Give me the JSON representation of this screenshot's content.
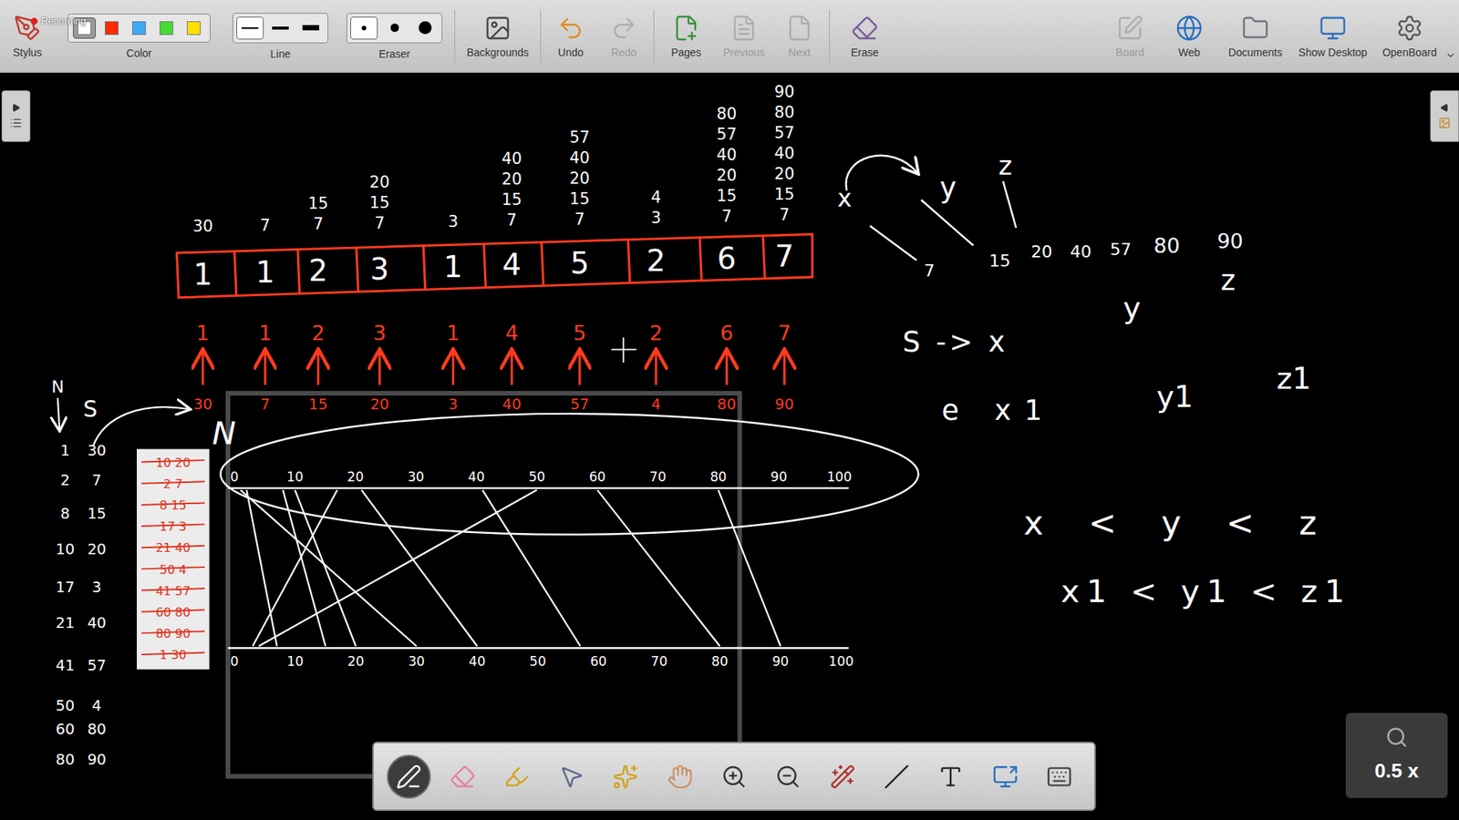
{
  "recorder": {
    "label": "Recording"
  },
  "toolbar": {
    "left": [
      {
        "kind": "stylus",
        "label": "Stylus",
        "disabled": false
      },
      {
        "kind": "color",
        "label": "Color",
        "disabled": false,
        "options": [
          {
            "color": "#ffffff",
            "selected": true
          },
          {
            "color": "#ff2a00",
            "selected": false
          },
          {
            "color": "#3fa9f5",
            "selected": false
          },
          {
            "color": "#44dd33",
            "selected": false
          },
          {
            "color": "#ffe000",
            "selected": false
          }
        ]
      },
      {
        "kind": "line",
        "label": "Line",
        "disabled": false,
        "options": [
          {
            "selected": true
          },
          {
            "selected": false
          },
          {
            "selected": false
          }
        ]
      },
      {
        "kind": "eraser",
        "label": "Eraser",
        "disabled": false,
        "options": [
          {
            "selected": true
          },
          {
            "selected": false
          },
          {
            "selected": false
          }
        ]
      },
      {
        "kind": "backgrounds",
        "label": "Backgrounds",
        "disabled": false
      },
      {
        "kind": "undo",
        "label": "Undo",
        "disabled": false
      },
      {
        "kind": "redo",
        "label": "Redo",
        "disabled": true
      },
      {
        "kind": "pages",
        "label": "Pages",
        "disabled": false
      },
      {
        "kind": "previous",
        "label": "Previous",
        "disabled": true
      },
      {
        "kind": "next",
        "label": "Next",
        "disabled": true
      },
      {
        "kind": "erase",
        "label": "Erase",
        "disabled": false
      }
    ],
    "right": [
      {
        "kind": "board",
        "label": "Board",
        "disabled": true
      },
      {
        "kind": "web",
        "label": "Web",
        "disabled": false
      },
      {
        "kind": "documents",
        "label": "Documents",
        "disabled": false
      },
      {
        "kind": "desktop",
        "label": "Show Desktop",
        "disabled": false
      },
      {
        "kind": "openboard",
        "label": "OpenBoard",
        "disabled": false
      }
    ]
  },
  "tools": [
    {
      "kind": "pen",
      "selected": true
    },
    {
      "kind": "eraser",
      "selected": false
    },
    {
      "kind": "marker",
      "selected": false
    },
    {
      "kind": "selector",
      "selected": false
    },
    {
      "kind": "play",
      "selected": false
    },
    {
      "kind": "hand",
      "selected": false
    },
    {
      "kind": "zoom-in",
      "selected": false
    },
    {
      "kind": "zoom-out",
      "selected": false
    },
    {
      "kind": "laser",
      "selected": false
    },
    {
      "kind": "line",
      "selected": false
    },
    {
      "kind": "text",
      "selected": false
    },
    {
      "kind": "capture",
      "selected": false
    },
    {
      "kind": "keyboard",
      "selected": false
    }
  ],
  "zoom": {
    "label": "0.5 x"
  },
  "board": {
    "cells": [
      {
        "value": "1",
        "stack": [
          "30"
        ],
        "label": "1",
        "result": "30"
      },
      {
        "value": "1",
        "stack": [
          "7"
        ],
        "label": "1",
        "result": "7"
      },
      {
        "value": "2",
        "stack": [
          "15",
          "7"
        ],
        "label": "2",
        "result": "15"
      },
      {
        "value": "3",
        "stack": [
          "20",
          "15",
          "7"
        ],
        "label": "3",
        "result": "20"
      },
      {
        "value": "1",
        "stack": [
          "3"
        ],
        "label": "1",
        "result": "3"
      },
      {
        "value": "4",
        "stack": [
          "40",
          "20",
          "15",
          "7"
        ],
        "label": "4",
        "result": "40"
      },
      {
        "value": "5",
        "stack": [
          "57",
          "40",
          "20",
          "15",
          "7"
        ],
        "label": "5",
        "result": "57"
      },
      {
        "value": "2",
        "stack": [
          "4",
          "3"
        ],
        "label": "2",
        "result": "4"
      },
      {
        "value": "6",
        "stack": [
          "80",
          "57",
          "40",
          "20",
          "15",
          "7"
        ],
        "label": "6",
        "result": "80"
      },
      {
        "value": "7",
        "stack": [
          "90",
          "80",
          "57",
          "40",
          "20",
          "15",
          "7"
        ],
        "label": "7",
        "result": "90"
      }
    ],
    "header": [
      "N",
      "S"
    ],
    "pairs": [
      {
        "a": "1",
        "b": "30"
      },
      {
        "a": "2",
        "b": "7"
      },
      {
        "a": "8",
        "b": "15"
      },
      {
        "a": "10",
        "b": "20"
      },
      {
        "a": "17",
        "b": "3"
      },
      {
        "a": "21",
        "b": "40"
      },
      {
        "a": "41",
        "b": "57"
      },
      {
        "a": "50",
        "b": "4"
      },
      {
        "a": "60",
        "b": "80"
      },
      {
        "a": "80",
        "b": "90"
      }
    ],
    "paper": [
      {
        "text": "10 20",
        "struck": true
      },
      {
        "text": "2 7",
        "struck": true
      },
      {
        "text": "8 15",
        "struck": true
      },
      {
        "text": "17 3",
        "struck": true
      },
      {
        "text": "21 40",
        "struck": true
      },
      {
        "text": "50 4",
        "struck": true
      },
      {
        "text": "41 57",
        "struck": true
      },
      {
        "text": "60 80",
        "struck": true
      },
      {
        "text": "80 90",
        "struck": true
      },
      {
        "text": "1 30",
        "struck": true
      }
    ],
    "mark": "N",
    "top_axis": [
      "0",
      "10",
      "20",
      "30",
      "40",
      "50",
      "60",
      "70",
      "80",
      "90",
      "100"
    ],
    "bottom_axis": [
      "0",
      "10",
      "20",
      "30",
      "40",
      "50",
      "60",
      "70",
      "80",
      "90",
      "100"
    ],
    "notes": [
      "x",
      "y",
      "z",
      "7",
      "15",
      "20",
      "40",
      "57",
      "80",
      "90",
      "y",
      "z",
      "S -> x",
      "e x1",
      "y1",
      "z1",
      "x < y < z",
      "x1 < y1 < z1"
    ]
  }
}
